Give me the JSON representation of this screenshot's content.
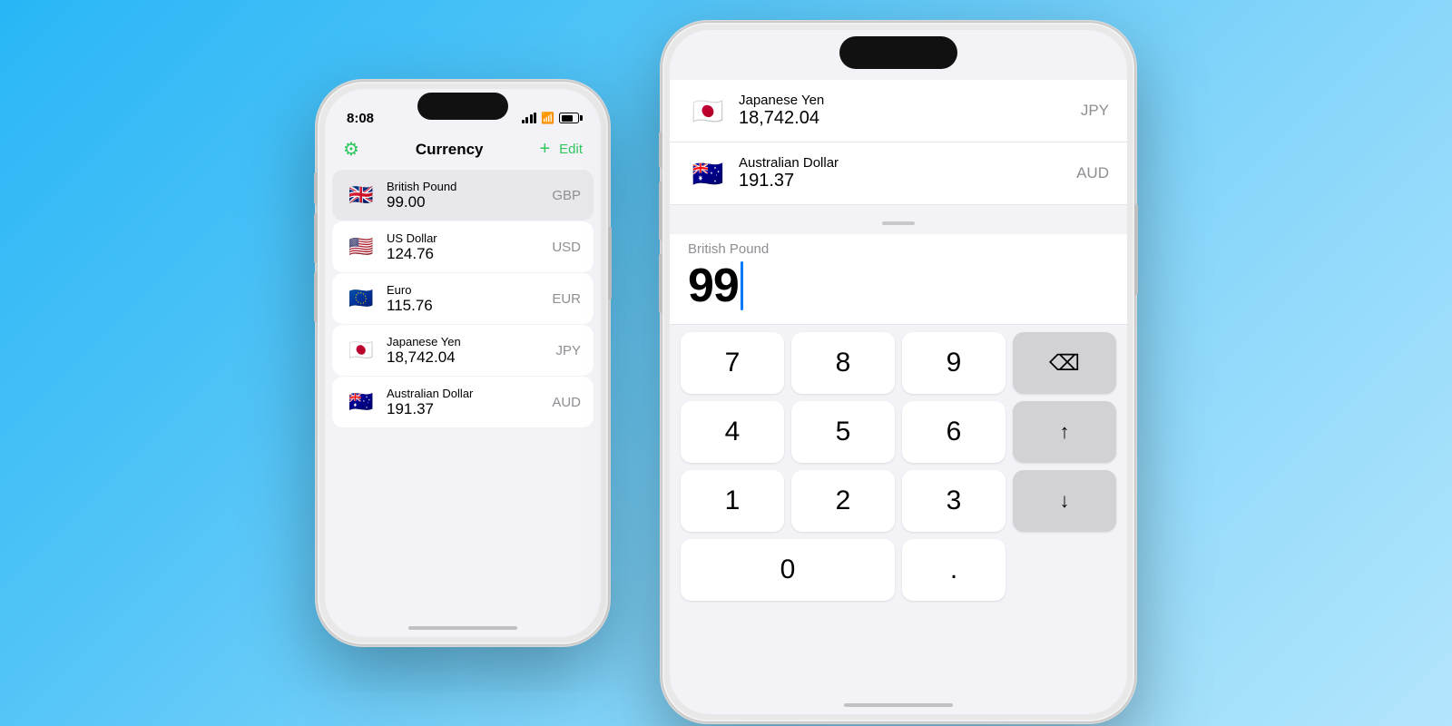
{
  "background": {
    "gradient_start": "#29b6f6",
    "gradient_end": "#b3e5fc"
  },
  "phone_left": {
    "status_bar": {
      "time": "8:08",
      "signal": "visible",
      "wifi": "visible",
      "battery": "visible"
    },
    "nav": {
      "settings_icon": "⚙",
      "title": "Currency",
      "plus_icon": "+",
      "edit_label": "Edit"
    },
    "currencies": [
      {
        "flag": "🇬🇧",
        "name": "British Pound",
        "value": "99.00",
        "code": "GBP",
        "active": true
      },
      {
        "flag": "🇺🇸",
        "name": "US Dollar",
        "value": "124.76",
        "code": "USD",
        "active": false
      },
      {
        "flag": "🇪🇺",
        "name": "Euro",
        "value": "115.76",
        "code": "EUR",
        "active": false
      },
      {
        "flag": "🇯🇵",
        "name": "Japanese Yen",
        "value": "18,742.04",
        "code": "JPY",
        "active": false
      },
      {
        "flag": "🇦🇺",
        "name": "Australian Dollar",
        "value": "191.37",
        "code": "AUD",
        "active": false
      }
    ]
  },
  "phone_right": {
    "scroll_items": [
      {
        "flag": "🇯🇵",
        "name": "Japanese Yen",
        "value": "18,742.04",
        "code": "JPY"
      },
      {
        "flag": "🇦🇺",
        "name": "Australian Dollar",
        "value": "191.37",
        "code": "AUD"
      }
    ],
    "active_currency": {
      "name": "British Pound",
      "value": "99",
      "cursor": true
    },
    "numpad": {
      "rows": [
        [
          "7",
          "8",
          "9",
          "⌫"
        ],
        [
          "4",
          "5",
          "6",
          "↑"
        ],
        [
          "1",
          "2",
          "3",
          "↓"
        ],
        [
          "0",
          ".",
          ""
        ]
      ]
    }
  }
}
